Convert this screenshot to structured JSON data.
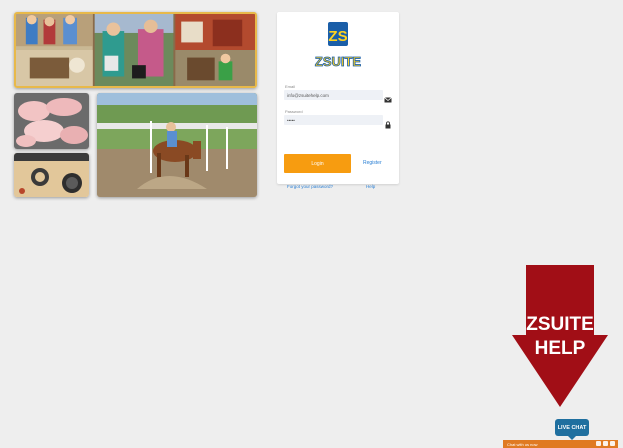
{
  "login": {
    "username_label": "Email",
    "username_value": "info@zsuitehelp.com",
    "password_label": "Password",
    "password_value": "•••••",
    "login_label": "Login",
    "register_label": "Register",
    "forgot_label": "Forgot your password?",
    "help_label": "Help"
  },
  "logo": {
    "text": "ZSUITE",
    "letters": "ZS",
    "colors": {
      "yellow": "#ffd21f",
      "blue": "#1a5ea8"
    }
  },
  "help": {
    "line1": "ZSUITE",
    "line2": "HELP",
    "color": "#a10e16"
  },
  "chat": {
    "live_chat_label": "LIVE CHAT",
    "bar_text": "Chat with us now",
    "color": "#e07a22"
  },
  "colors": {
    "accent": "#f79c10",
    "link": "#2a7fd4",
    "collage_border": "#e8b94a"
  },
  "icons": {
    "email": "envelope-icon",
    "password": "lock-icon"
  }
}
